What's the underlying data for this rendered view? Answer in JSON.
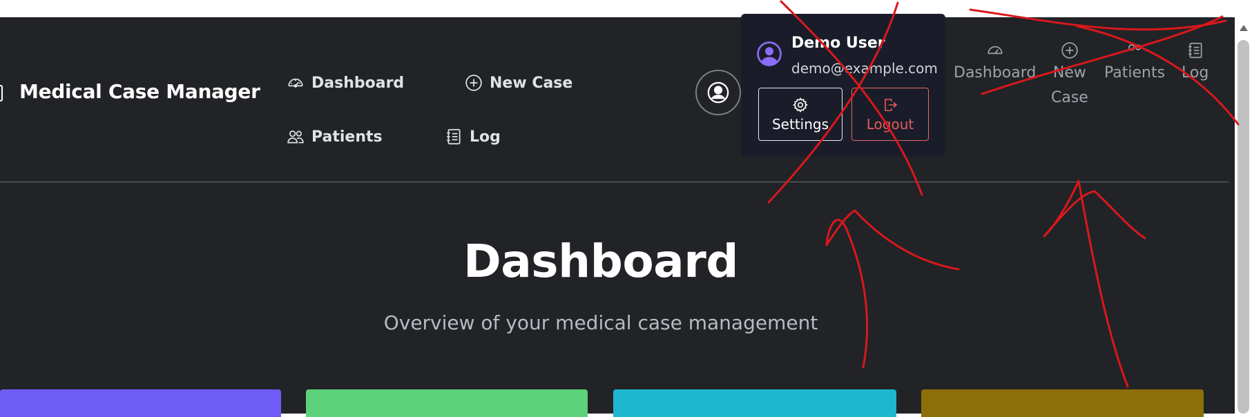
{
  "brand": {
    "title": "Medical Case Manager"
  },
  "nav": {
    "dashboard": {
      "label": "Dashboard",
      "icon": "speedometer-icon"
    },
    "new_case": {
      "label": "New Case",
      "icon": "plus-circle-icon"
    },
    "patients": {
      "label": "Patients",
      "icon": "people-icon"
    },
    "log": {
      "label": "Log",
      "icon": "journal-icon"
    }
  },
  "user_menu": {
    "name": "Demo User",
    "email": "demo@example.com",
    "settings_label": "Settings",
    "logout_label": "Logout"
  },
  "collapsed_nav": {
    "dashboard": "Dashboard",
    "new_case_line1": "New",
    "new_case_line2": "Case",
    "patients": "Patients",
    "log": "Log"
  },
  "page": {
    "title": "Dashboard",
    "subtitle": "Overview of your medical case management"
  },
  "stat_cards": [
    {
      "color": "#6f5cf6"
    },
    {
      "color": "#5cd37a"
    },
    {
      "color": "#1fb6d0"
    },
    {
      "color": "#8b6f08"
    }
  ],
  "colors": {
    "background": "#212327",
    "dropdown_bg": "#1a1d29",
    "logout": "#e65b5b",
    "annotation_red": "#d9181c"
  }
}
